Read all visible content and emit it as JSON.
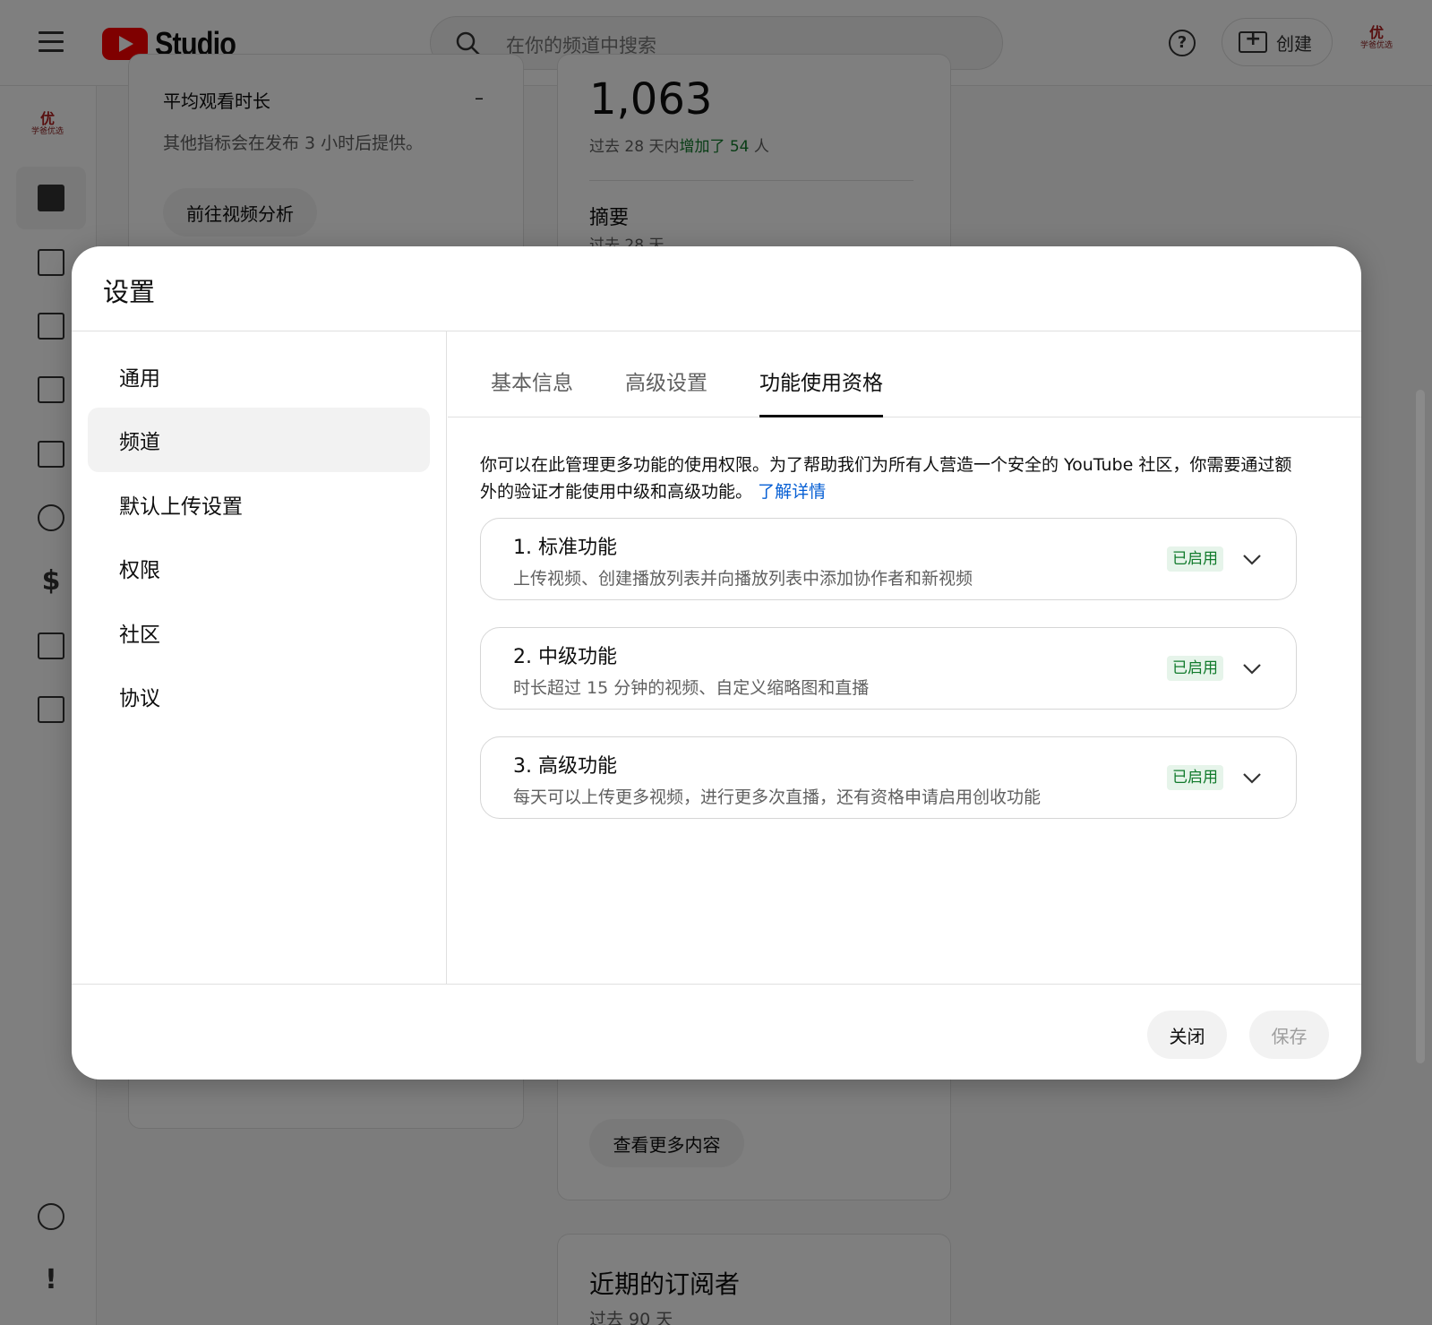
{
  "header": {
    "logo_text": "Studio",
    "search_placeholder": "在你的频道中搜索",
    "help_label": "?",
    "create_label": "创建",
    "avatar_initial": "优",
    "avatar_text": "学爸优选"
  },
  "background": {
    "avg_watch_label": "平均观看时长",
    "avg_watch_value": "–",
    "metrics_note": "其他指标会在发布 3 小时后提供。",
    "video_analytics_button": "前往视频分析",
    "subscriber_count": "1,063",
    "subscriber_period": "过去 28 天内",
    "subscriber_delta": "增加了 54",
    "subscriber_unit": " 人",
    "summary_title": "摘要",
    "summary_period": "过去 28 天",
    "see_more_button": "查看更多内容",
    "recent_subs_title": "近期的订阅者",
    "recent_subs_period": "过去 90 天"
  },
  "dialog": {
    "title": "设置",
    "sidebar": [
      "通用",
      "频道",
      "默认上传设置",
      "权限",
      "社区",
      "协议"
    ],
    "active_sidebar": "频道",
    "tabs": [
      "基本信息",
      "高级设置",
      "功能使用资格"
    ],
    "active_tab": "功能使用资格",
    "intro_text": "你可以在此管理更多功能的使用权限。为了帮助我们为所有人营造一个安全的 YouTube 社区，你需要通过额外的验证才能使用中级和高级功能。",
    "learn_more": "了解详情",
    "features": [
      {
        "title": "1. 标准功能",
        "desc": "上传视频、创建播放列表并向播放列表中添加协作者和新视频",
        "status": "已启用"
      },
      {
        "title": "2. 中级功能",
        "desc": "时长超过 15 分钟的视频、自定义缩略图和直播",
        "status": "已启用"
      },
      {
        "title": "3. 高级功能",
        "desc": "每天可以上传更多视频，进行更多次直播，还有资格申请启用创收功能",
        "status": "已启用"
      }
    ],
    "close_button": "关闭",
    "save_button": "保存"
  },
  "colors": {
    "brand_red": "#ff0000",
    "link_blue": "#065fd4",
    "enabled_green": "#107a2b",
    "enabled_bg": "#e6f4ea"
  }
}
